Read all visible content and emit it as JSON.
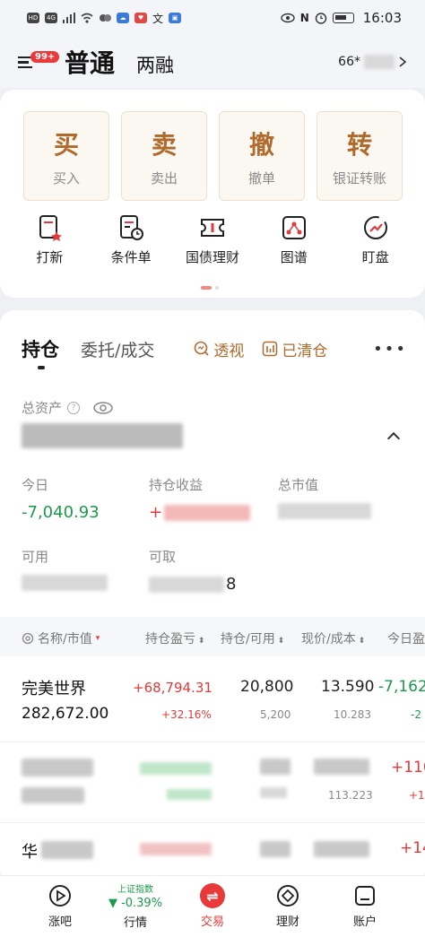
{
  "status_bar": {
    "time": "16:03",
    "left_icons": [
      "HD",
      "4G",
      "signal-icon",
      "wifi-icon",
      "app-icon",
      "cloud-icon",
      "heart-icon",
      "translate-icon",
      "app-icon"
    ],
    "right_icons": [
      "eye-icon",
      "nfc-icon",
      "alarm-icon",
      "battery-icon"
    ]
  },
  "header": {
    "badge": "99+",
    "tab_main": "普通",
    "tab_margin": "两融",
    "account": "66*"
  },
  "trade_buttons": [
    {
      "big": "买",
      "small": "买入"
    },
    {
      "big": "卖",
      "small": "卖出"
    },
    {
      "big": "撤",
      "small": "撤单"
    },
    {
      "big": "转",
      "small": "银证转账"
    }
  ],
  "quick_icons": [
    {
      "icon": "ipo-icon",
      "label": "打新"
    },
    {
      "icon": "condition-order-icon",
      "label": "条件单"
    },
    {
      "icon": "bond-icon",
      "label": "国债理财"
    },
    {
      "icon": "chart-icon",
      "label": "图谱"
    },
    {
      "icon": "watch-icon",
      "label": "盯盘"
    }
  ],
  "positions": {
    "tab_active": "持仓",
    "tab_orders": "委托/成交",
    "tab_perspective": "透视",
    "tab_cleared": "已清仓",
    "total_asset_label": "总资产",
    "today_label": "今日",
    "today_value": "-7,040.93",
    "profit_label": "持仓收益",
    "profit_value": "+",
    "market_value_label": "总市值",
    "available_label": "可用",
    "withdrawable_label": "可取",
    "withdrawable_tail": "8"
  },
  "table": {
    "headers": [
      "名称/市值",
      "持仓盈亏",
      "持仓/可用",
      "现价/成本",
      "今日盈"
    ],
    "rows": [
      {
        "name": "完美世界",
        "market_value": "282,672.00",
        "pnl": "+68,794.31",
        "pnl_pct": "+32.16%",
        "hold": "20,800",
        "avail": "5,200",
        "price": "13.590",
        "cost": "10.283",
        "today": "-7,162",
        "today_pct": "-2"
      },
      {
        "name": "",
        "market_value": "",
        "pnl": "",
        "pnl_pct": "",
        "hold": "",
        "avail": "",
        "price": "",
        "cost": "113.223",
        "today": "+110",
        "today_pct": "+1"
      },
      {
        "name": "华",
        "market_value": "",
        "pnl": "",
        "pnl_pct": "",
        "hold": "",
        "avail": "",
        "price": "",
        "cost": "",
        "today": "+14",
        "today_pct": ""
      }
    ]
  },
  "bottom_nav": {
    "items": [
      "涨吧",
      "行情",
      "交易",
      "理财",
      "账户"
    ],
    "index_name": "上证指数",
    "index_value": "▼ -0.39%",
    "trade_icon_symbol": "⇌"
  }
}
